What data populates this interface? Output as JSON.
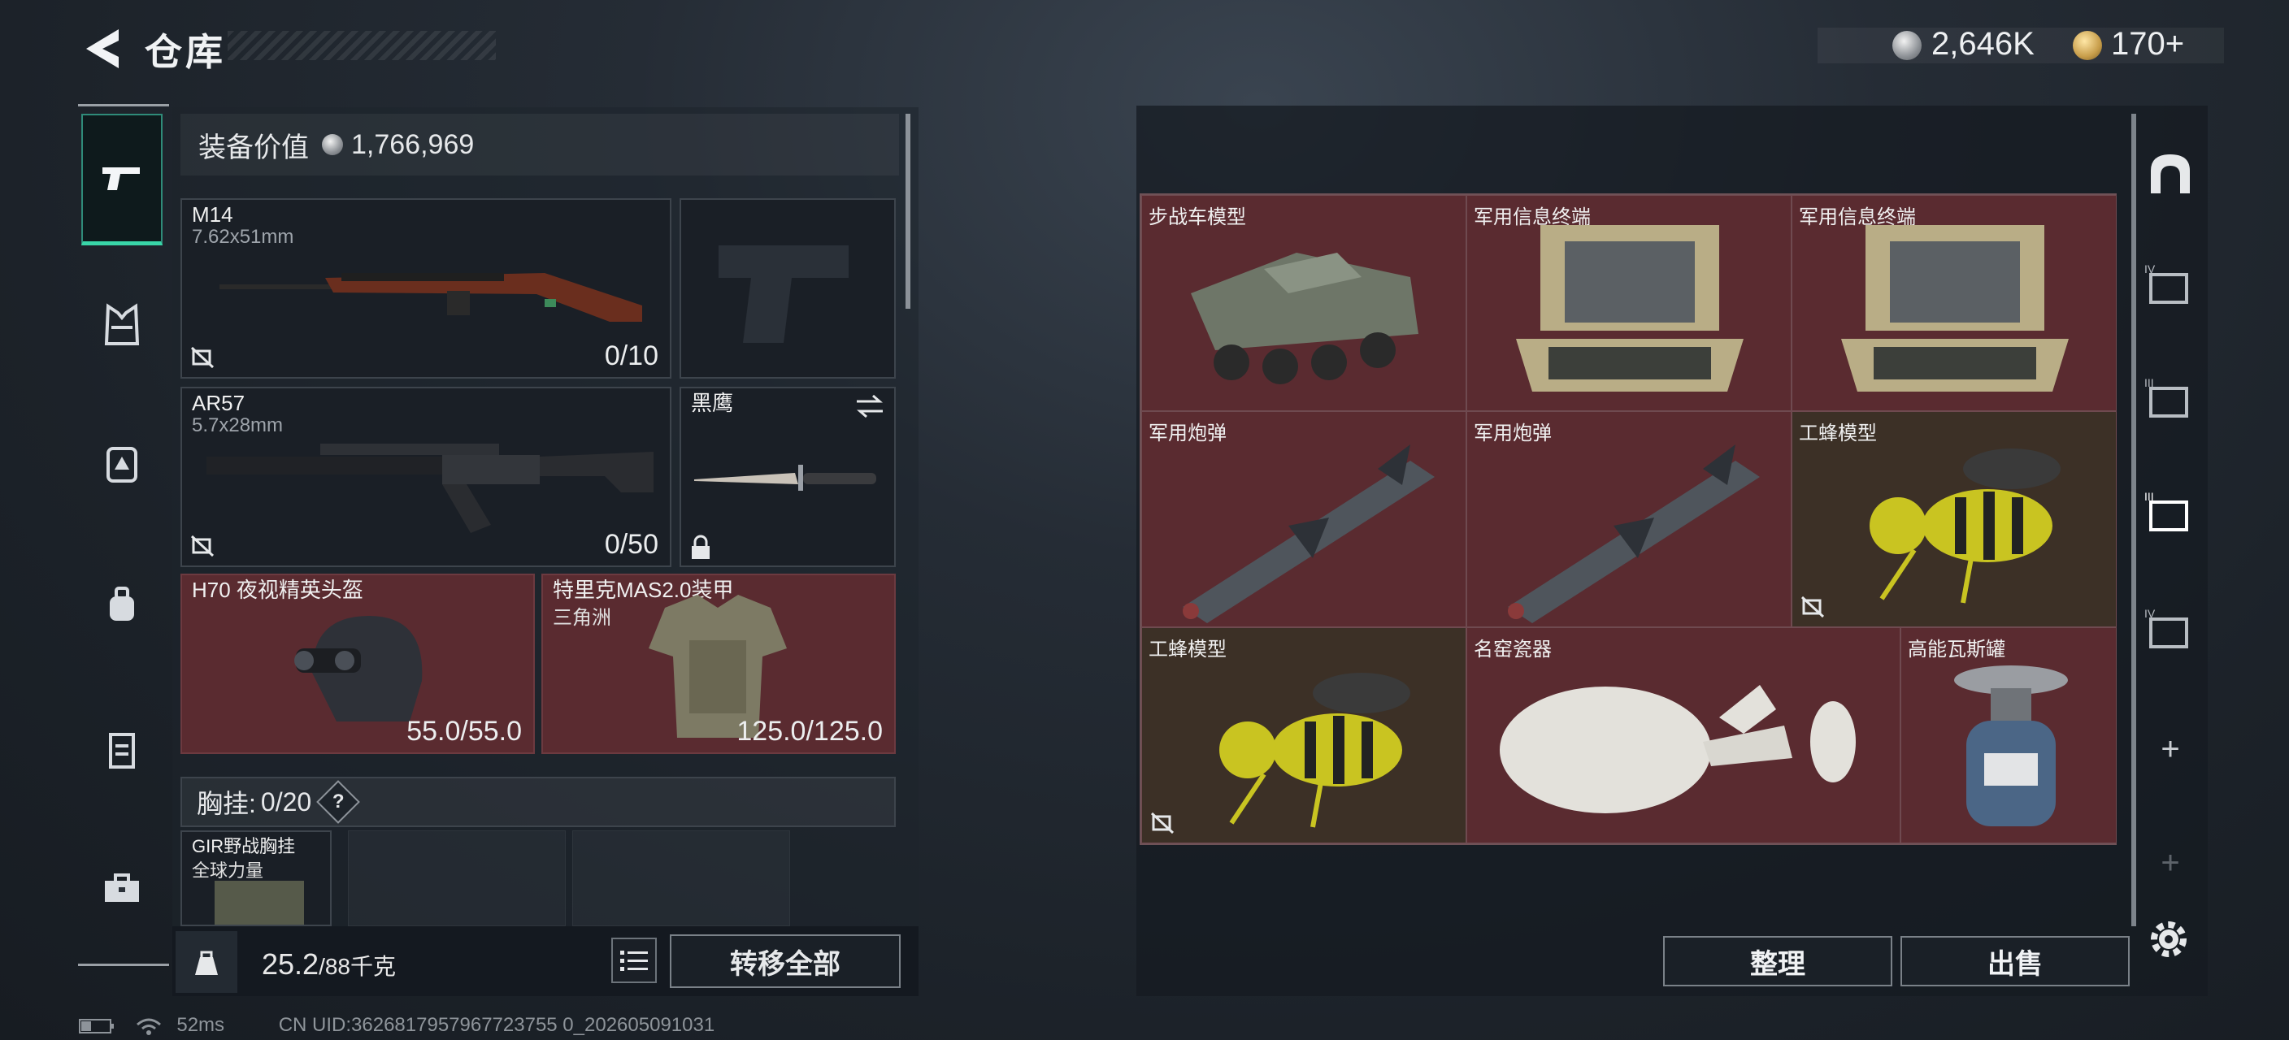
{
  "header": {
    "title": "仓库",
    "silver": "2,646K",
    "gold": "170+"
  },
  "equipment": {
    "value_label": "装备价值",
    "value": "1,766,969",
    "slots": [
      {
        "name": "M14",
        "sub": "7.62x51mm",
        "count": "0/10"
      },
      {
        "name": "AR57",
        "sub": "5.7x28mm",
        "count": "0/50"
      },
      {
        "name": "黑鹰"
      },
      {
        "name": "H70 夜视精英头盔",
        "count": "55.0/55.0"
      },
      {
        "name": "特里克MAS2.0装甲",
        "sub": "三角洲",
        "count": "125.0/125.0"
      },
      {
        "name": "GIR野战胸挂",
        "sub": "全球力量"
      }
    ],
    "chest": {
      "label": "胸挂:",
      "count": "0/20",
      "help": "?"
    },
    "weight": {
      "current": "25.2",
      "max": "/88千克"
    },
    "transfer_all": "转移全部"
  },
  "storage": {
    "cells": [
      {
        "name": "步战车模型"
      },
      {
        "name": "军用信息终端"
      },
      {
        "name": "军用信息终端"
      },
      {
        "name": "军用炮弹"
      },
      {
        "name": "军用炮弹"
      },
      {
        "name": "工蜂模型"
      },
      {
        "name": "工蜂模型"
      },
      {
        "name": "名窑瓷器"
      },
      {
        "name": "高能瓦斯罐"
      }
    ],
    "sort": "整理",
    "sell": "出售",
    "side_labels": [
      "IV",
      "III",
      "III",
      "IV",
      "+",
      "+"
    ]
  },
  "status": {
    "ping": "52ms",
    "uid": "CN UID:3626817957967723755 0_202605091031"
  }
}
